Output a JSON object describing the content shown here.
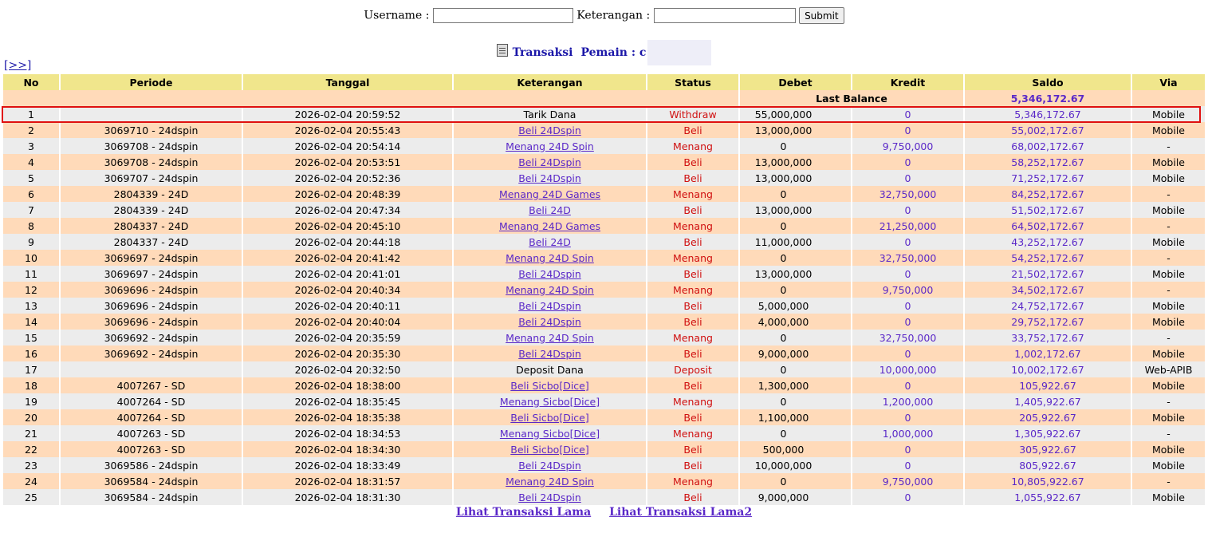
{
  "search": {
    "username_label": "Username :",
    "username_value": "",
    "keterangan_label": "Keterangan :",
    "keterangan_value": "",
    "submit_label": "Submit"
  },
  "title": {
    "transaksi": "Transaksi",
    "pemain_label": "Pemain : c"
  },
  "next_link": "[>>]",
  "columns": [
    "No",
    "Periode",
    "Tanggal",
    "Keterangan",
    "Status",
    "Debet",
    "Kredit",
    "Saldo",
    "Via"
  ],
  "last_balance": {
    "label": "Last Balance",
    "value": "5,346,172.67"
  },
  "rows": [
    {
      "no": "1",
      "periode": "",
      "tanggal": "2026-02-04 20:59:52",
      "keterangan": "Tarik Dana",
      "ket_link": false,
      "status": "Withdraw",
      "debet": "55,000,000",
      "kredit": "0",
      "saldo": "5,346,172.67",
      "via": "Mobile"
    },
    {
      "no": "2",
      "periode": "3069710 - 24dspin",
      "tanggal": "2026-02-04 20:55:43",
      "keterangan": "Beli 24Dspin",
      "ket_link": true,
      "status": "Beli",
      "debet": "13,000,000",
      "kredit": "0",
      "saldo": "55,002,172.67",
      "via": "Mobile"
    },
    {
      "no": "3",
      "periode": "3069708 - 24dspin",
      "tanggal": "2026-02-04 20:54:14",
      "keterangan": "Menang 24D Spin",
      "ket_link": true,
      "status": "Menang",
      "debet": "0",
      "kredit": "9,750,000",
      "saldo": "68,002,172.67",
      "via": "-"
    },
    {
      "no": "4",
      "periode": "3069708 - 24dspin",
      "tanggal": "2026-02-04 20:53:51",
      "keterangan": "Beli 24Dspin",
      "ket_link": true,
      "status": "Beli",
      "debet": "13,000,000",
      "kredit": "0",
      "saldo": "58,252,172.67",
      "via": "Mobile"
    },
    {
      "no": "5",
      "periode": "3069707 - 24dspin",
      "tanggal": "2026-02-04 20:52:36",
      "keterangan": "Beli 24Dspin",
      "ket_link": true,
      "status": "Beli",
      "debet": "13,000,000",
      "kredit": "0",
      "saldo": "71,252,172.67",
      "via": "Mobile"
    },
    {
      "no": "6",
      "periode": "2804339 - 24D",
      "tanggal": "2026-02-04 20:48:39",
      "keterangan": "Menang 24D Games",
      "ket_link": true,
      "status": "Menang",
      "debet": "0",
      "kredit": "32,750,000",
      "saldo": "84,252,172.67",
      "via": "-"
    },
    {
      "no": "7",
      "periode": "2804339 - 24D",
      "tanggal": "2026-02-04 20:47:34",
      "keterangan": "Beli 24D",
      "ket_link": true,
      "status": "Beli",
      "debet": "13,000,000",
      "kredit": "0",
      "saldo": "51,502,172.67",
      "via": "Mobile"
    },
    {
      "no": "8",
      "periode": "2804337 - 24D",
      "tanggal": "2026-02-04 20:45:10",
      "keterangan": "Menang 24D Games",
      "ket_link": true,
      "status": "Menang",
      "debet": "0",
      "kredit": "21,250,000",
      "saldo": "64,502,172.67",
      "via": "-"
    },
    {
      "no": "9",
      "periode": "2804337 - 24D",
      "tanggal": "2026-02-04 20:44:18",
      "keterangan": "Beli 24D",
      "ket_link": true,
      "status": "Beli",
      "debet": "11,000,000",
      "kredit": "0",
      "saldo": "43,252,172.67",
      "via": "Mobile"
    },
    {
      "no": "10",
      "periode": "3069697 - 24dspin",
      "tanggal": "2026-02-04 20:41:42",
      "keterangan": "Menang 24D Spin",
      "ket_link": true,
      "status": "Menang",
      "debet": "0",
      "kredit": "32,750,000",
      "saldo": "54,252,172.67",
      "via": "-"
    },
    {
      "no": "11",
      "periode": "3069697 - 24dspin",
      "tanggal": "2026-02-04 20:41:01",
      "keterangan": "Beli 24Dspin",
      "ket_link": true,
      "status": "Beli",
      "debet": "13,000,000",
      "kredit": "0",
      "saldo": "21,502,172.67",
      "via": "Mobile"
    },
    {
      "no": "12",
      "periode": "3069696 - 24dspin",
      "tanggal": "2026-02-04 20:40:34",
      "keterangan": "Menang 24D Spin",
      "ket_link": true,
      "status": "Menang",
      "debet": "0",
      "kredit": "9,750,000",
      "saldo": "34,502,172.67",
      "via": "-"
    },
    {
      "no": "13",
      "periode": "3069696 - 24dspin",
      "tanggal": "2026-02-04 20:40:11",
      "keterangan": "Beli 24Dspin",
      "ket_link": true,
      "status": "Beli",
      "debet": "5,000,000",
      "kredit": "0",
      "saldo": "24,752,172.67",
      "via": "Mobile"
    },
    {
      "no": "14",
      "periode": "3069696 - 24dspin",
      "tanggal": "2026-02-04 20:40:04",
      "keterangan": "Beli 24Dspin",
      "ket_link": true,
      "status": "Beli",
      "debet": "4,000,000",
      "kredit": "0",
      "saldo": "29,752,172.67",
      "via": "Mobile"
    },
    {
      "no": "15",
      "periode": "3069692 - 24dspin",
      "tanggal": "2026-02-04 20:35:59",
      "keterangan": "Menang 24D Spin",
      "ket_link": true,
      "status": "Menang",
      "debet": "0",
      "kredit": "32,750,000",
      "saldo": "33,752,172.67",
      "via": "-"
    },
    {
      "no": "16",
      "periode": "3069692 - 24dspin",
      "tanggal": "2026-02-04 20:35:30",
      "keterangan": "Beli 24Dspin",
      "ket_link": true,
      "status": "Beli",
      "debet": "9,000,000",
      "kredit": "0",
      "saldo": "1,002,172.67",
      "via": "Mobile"
    },
    {
      "no": "17",
      "periode": "",
      "tanggal": "2026-02-04 20:32:50",
      "keterangan": "Deposit Dana",
      "ket_link": false,
      "status": "Deposit",
      "debet": "0",
      "kredit": "10,000,000",
      "saldo": "10,002,172.67",
      "via": "Web-APIB"
    },
    {
      "no": "18",
      "periode": "4007267 - SD",
      "tanggal": "2026-02-04 18:38:00",
      "keterangan": "Beli Sicbo[Dice]",
      "ket_link": true,
      "status": "Beli",
      "debet": "1,300,000",
      "kredit": "0",
      "saldo": "105,922.67",
      "via": "Mobile"
    },
    {
      "no": "19",
      "periode": "4007264 - SD",
      "tanggal": "2026-02-04 18:35:45",
      "keterangan": "Menang Sicbo[Dice]",
      "ket_link": true,
      "status": "Menang",
      "debet": "0",
      "kredit": "1,200,000",
      "saldo": "1,405,922.67",
      "via": "-"
    },
    {
      "no": "20",
      "periode": "4007264 - SD",
      "tanggal": "2026-02-04 18:35:38",
      "keterangan": "Beli Sicbo[Dice]",
      "ket_link": true,
      "status": "Beli",
      "debet": "1,100,000",
      "kredit": "0",
      "saldo": "205,922.67",
      "via": "Mobile"
    },
    {
      "no": "21",
      "periode": "4007263 - SD",
      "tanggal": "2026-02-04 18:34:53",
      "keterangan": "Menang Sicbo[Dice]",
      "ket_link": true,
      "status": "Menang",
      "debet": "0",
      "kredit": "1,000,000",
      "saldo": "1,305,922.67",
      "via": "-"
    },
    {
      "no": "22",
      "periode": "4007263 - SD",
      "tanggal": "2026-02-04 18:34:30",
      "keterangan": "Beli Sicbo[Dice]",
      "ket_link": true,
      "status": "Beli",
      "debet": "500,000",
      "kredit": "0",
      "saldo": "305,922.67",
      "via": "Mobile"
    },
    {
      "no": "23",
      "periode": "3069586 - 24dspin",
      "tanggal": "2026-02-04 18:33:49",
      "keterangan": "Beli 24Dspin",
      "ket_link": true,
      "status": "Beli",
      "debet": "10,000,000",
      "kredit": "0",
      "saldo": "805,922.67",
      "via": "Mobile"
    },
    {
      "no": "24",
      "periode": "3069584 - 24dspin",
      "tanggal": "2026-02-04 18:31:57",
      "keterangan": "Menang 24D Spin",
      "ket_link": true,
      "status": "Menang",
      "debet": "0",
      "kredit": "9,750,000",
      "saldo": "10,805,922.67",
      "via": "-"
    },
    {
      "no": "25",
      "periode": "3069584 - 24dspin",
      "tanggal": "2026-02-04 18:31:30",
      "keterangan": "Beli 24Dspin",
      "ket_link": true,
      "status": "Beli",
      "debet": "9,000,000",
      "kredit": "0",
      "saldo": "1,055,922.67",
      "via": "Mobile"
    }
  ],
  "footer": {
    "lihat_lama": "Lihat Transaksi Lama",
    "lihat_lama2": "Lihat Transaksi Lama2"
  },
  "colors": {
    "header_bg": "#f0e68c",
    "row_even": "#ffdab9",
    "row_odd": "#ececec",
    "link": "#5a28c8",
    "status": "#d01010",
    "highlight": "#e01010"
  },
  "icons": {
    "title_icon": "document-icon"
  }
}
